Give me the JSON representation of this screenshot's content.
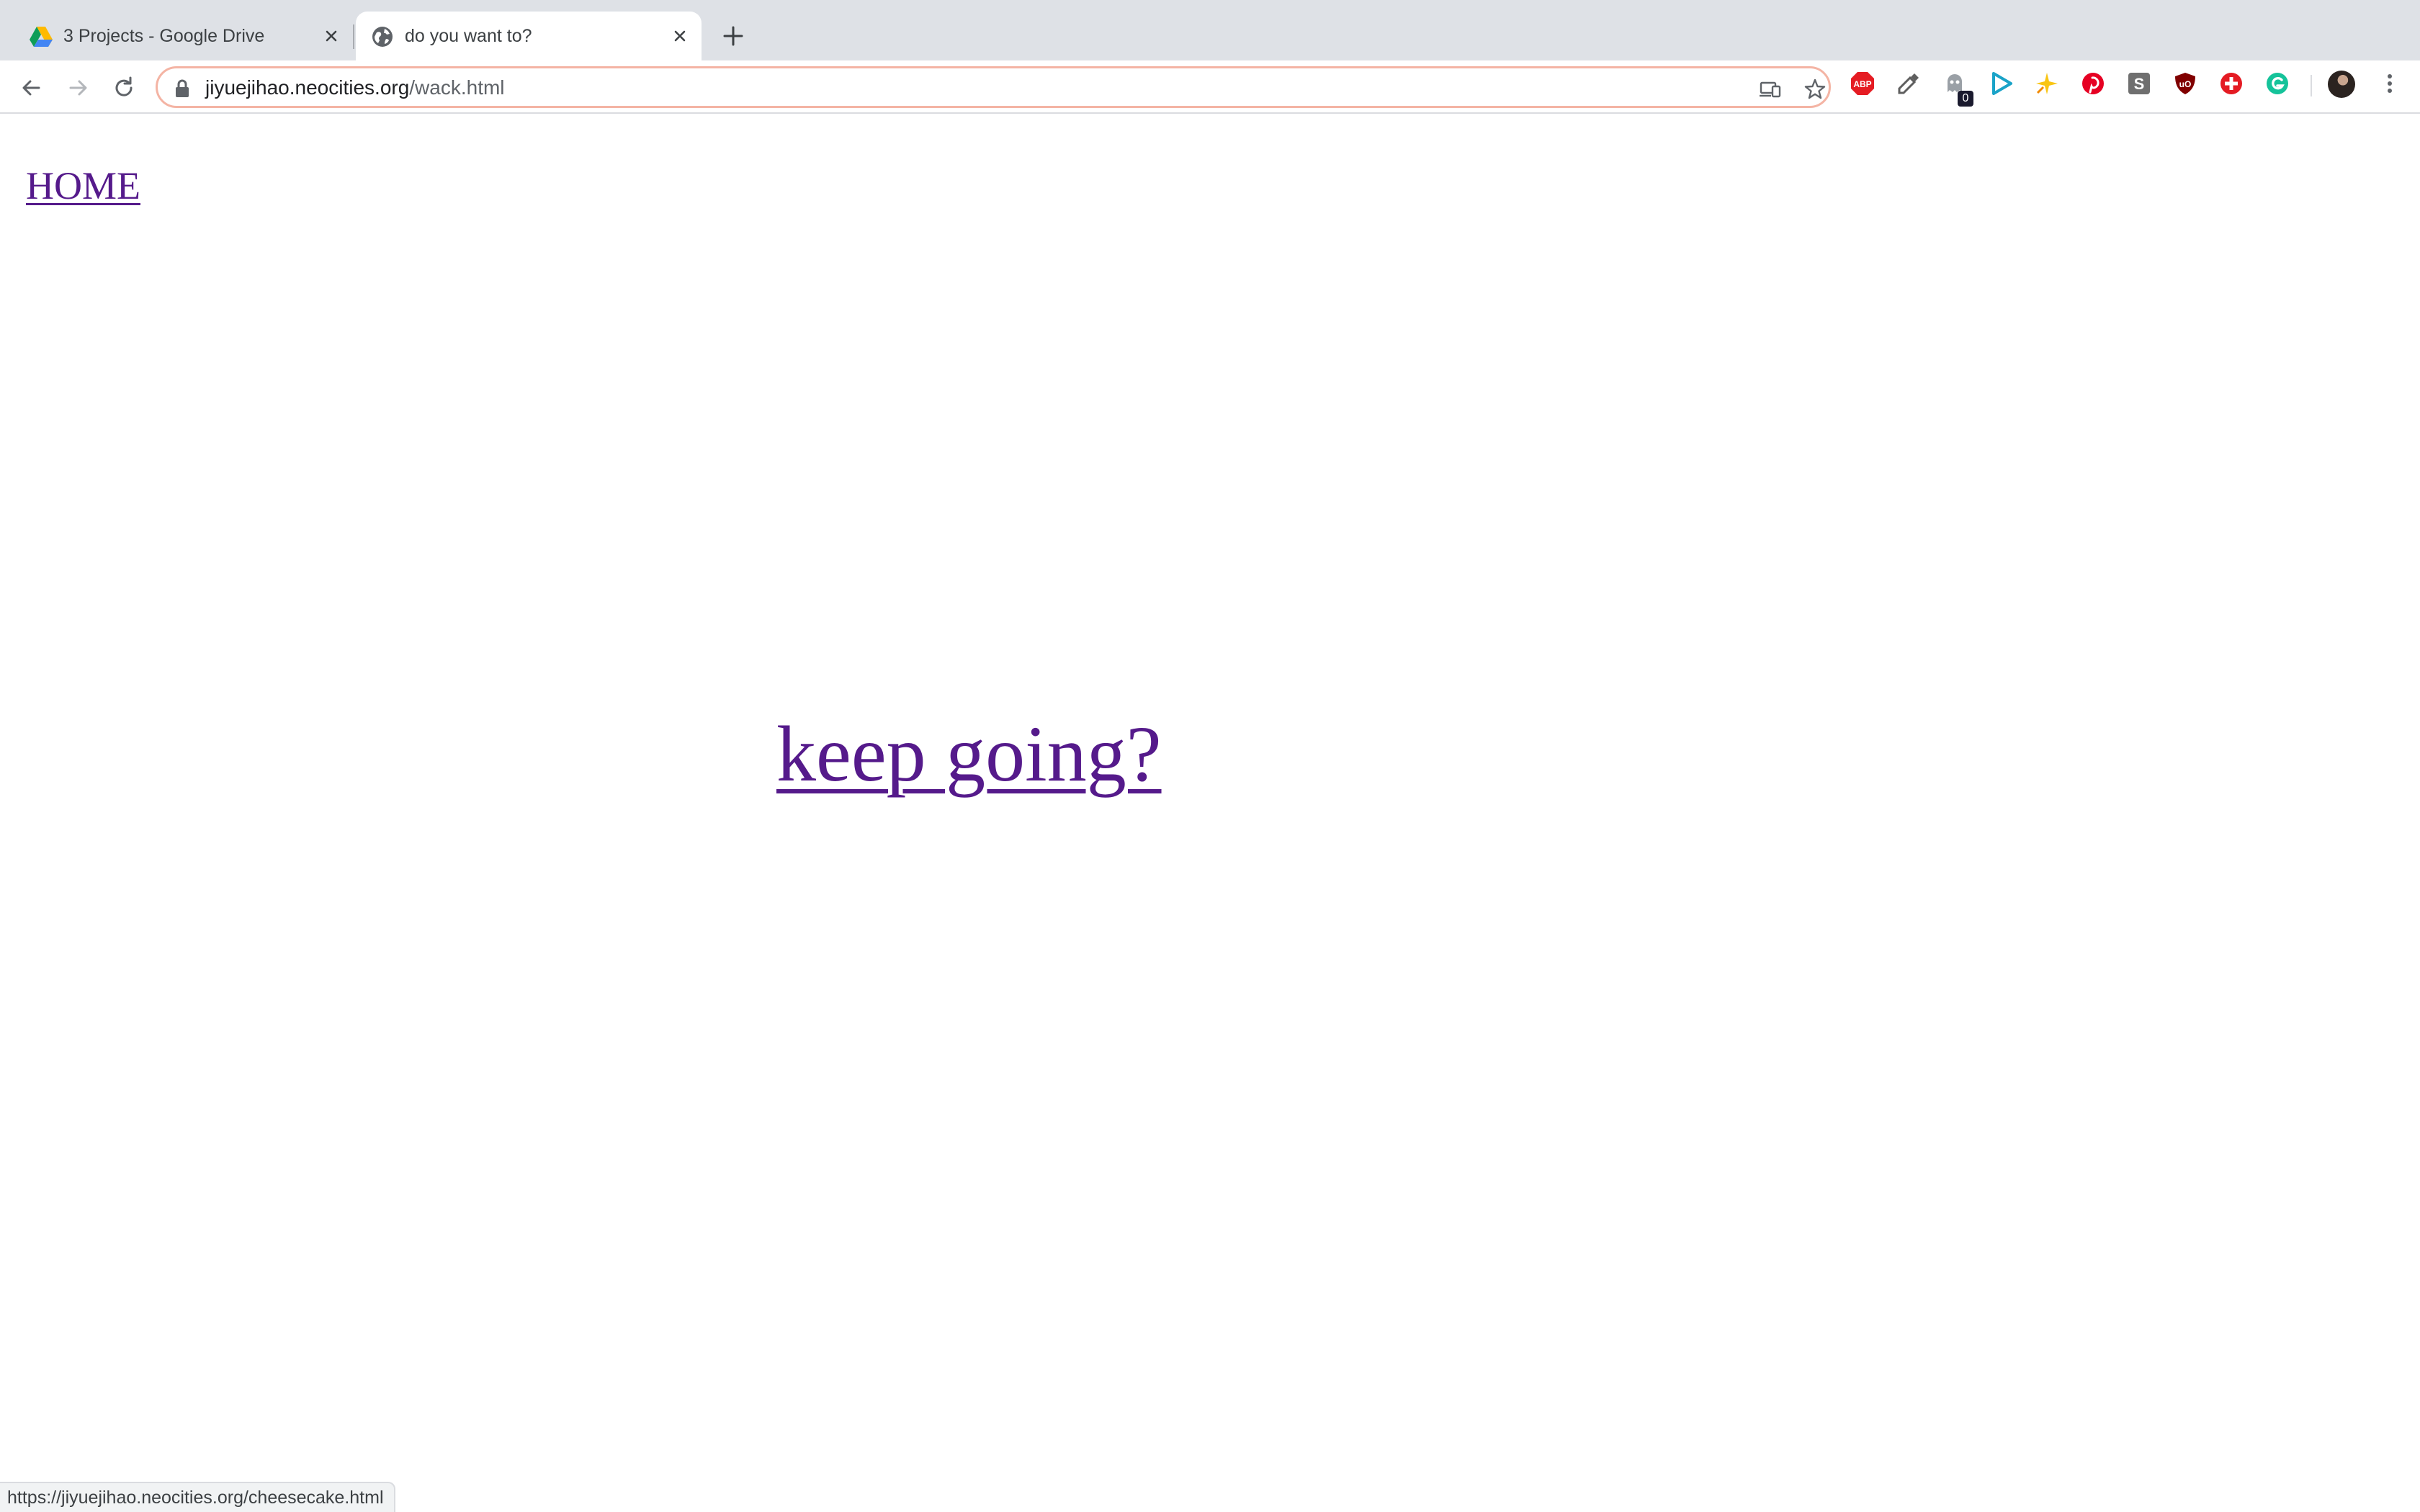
{
  "tabs": [
    {
      "title": "3 Projects - Google Drive",
      "favicon": "google-drive-icon",
      "active": false
    },
    {
      "title": "do you want to?",
      "favicon": "globe-icon",
      "active": true
    }
  ],
  "toolbar": {
    "url_host": "jiyuejihao.neocities.org",
    "url_path": "/wack.html",
    "extension_badge": "0",
    "extensions": [
      "adblock-plus-icon",
      "pipette-icon",
      "ghostery-icon",
      "play-icon",
      "sparkle-icon",
      "pinterest-icon",
      "s-icon",
      "ublock-icon",
      "plus-cross-icon",
      "grammarly-icon"
    ]
  },
  "page": {
    "home_link": "HOME",
    "keep_link": "keep going?"
  },
  "status_bar": {
    "hover_url": "https://jiyuejihao.neocities.org/cheesecake.html"
  },
  "colors": {
    "visited_link": "#551a8b",
    "tabstrip": "#dee1e6",
    "omnibox_focus": "#f4b4a4"
  }
}
